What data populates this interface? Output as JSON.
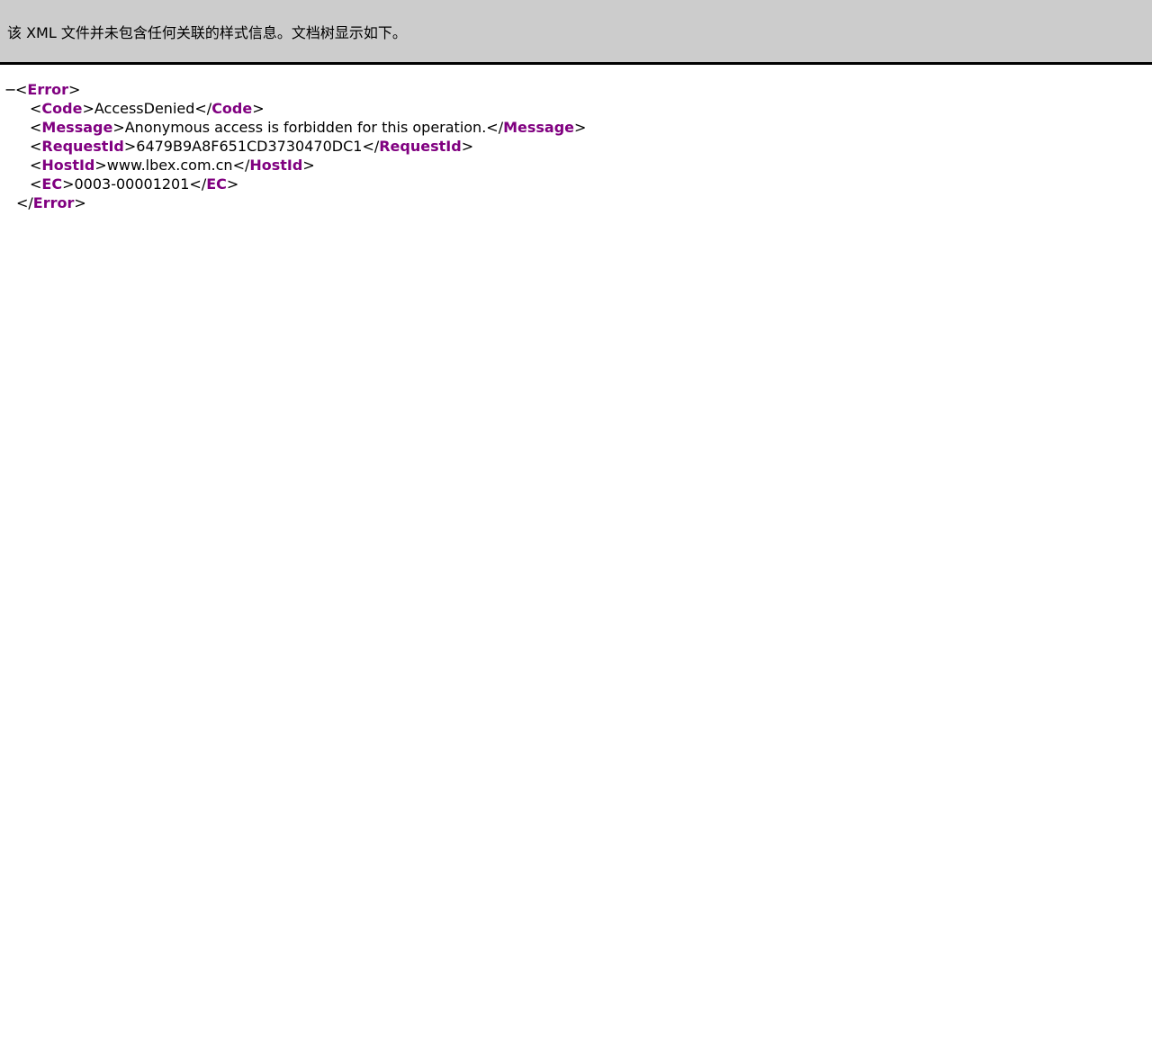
{
  "info_bar": {
    "message": "该 XML 文件并未包含任何关联的样式信息。文档树显示如下。"
  },
  "xml_tree": {
    "toggle_symbol": "−",
    "root_tag": "Error",
    "children": [
      {
        "tag": "Code",
        "value": "AccessDenied"
      },
      {
        "tag": "Message",
        "value": "Anonymous access is forbidden for this operation."
      },
      {
        "tag": "RequestId",
        "value": "6479B9A8F651CD3730470DC1"
      },
      {
        "tag": "HostId",
        "value": "www.lbex.com.cn"
      },
      {
        "tag": "EC",
        "value": "0003-00001201"
      }
    ]
  },
  "colors": {
    "info_bar_background": "#cccccc",
    "tag_name": "#800080",
    "divider": "#000000"
  }
}
